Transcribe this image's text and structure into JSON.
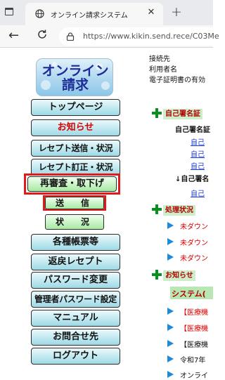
{
  "browser": {
    "tab_title": "オンライン請求システム",
    "tab_close": "✕",
    "new_tab": "+",
    "back": "←",
    "url": "https://www.kikin.send.rece/C03Me"
  },
  "logo": {
    "line1": "オンライン",
    "line2": "請求"
  },
  "sidebar": {
    "items": [
      {
        "label": "トップページ",
        "color": "#111111"
      },
      {
        "label": "お知らせ",
        "color": "#e00000"
      },
      {
        "label": "レセプト送信・状況",
        "color": "#111111"
      },
      {
        "label": "レセプト訂正・状況",
        "color": "#111111"
      },
      {
        "label": "再審査・取下げ",
        "color": "#111111"
      },
      {
        "label": "送　信",
        "color": "#111111"
      },
      {
        "label": "状　況",
        "color": "#111111"
      },
      {
        "label": "各種帳票等",
        "color": "#111111"
      },
      {
        "label": "返戻レセプト",
        "color": "#111111"
      },
      {
        "label": "パスワード変更",
        "color": "#111111"
      },
      {
        "label": "管理者パスワード設定",
        "color": "#111111"
      },
      {
        "label": "マニュアル",
        "color": "#111111"
      },
      {
        "label": "お問合せ先",
        "color": "#111111"
      },
      {
        "label": "ログアウト",
        "color": "#111111"
      }
    ],
    "highlight_color": "#e01b1b"
  },
  "main": {
    "info": [
      "接続先",
      "利用者名",
      "電子証明書の有効"
    ],
    "cert_section": {
      "heading": "自己署名証",
      "bold1": "自己署名証",
      "links": [
        "自己",
        "自己",
        "自己"
      ],
      "bold2": "↓自己署名",
      "link4": "自己"
    },
    "status_section": {
      "heading": "処理状況",
      "items": [
        "未ダウン",
        "未ダウン",
        "未ダウン"
      ]
    },
    "notice_section": {
      "heading": "お知らせ",
      "system_label": "システム(",
      "items": [
        {
          "text": "【医療機",
          "color": "#e00000"
        },
        {
          "text": "【医療機",
          "color": "#e00000"
        },
        {
          "text": "【医療機",
          "color": "#111111"
        },
        {
          "text": "令和7年",
          "color": "#111111"
        },
        {
          "text": "オンライ",
          "color": "#111111"
        }
      ]
    }
  }
}
